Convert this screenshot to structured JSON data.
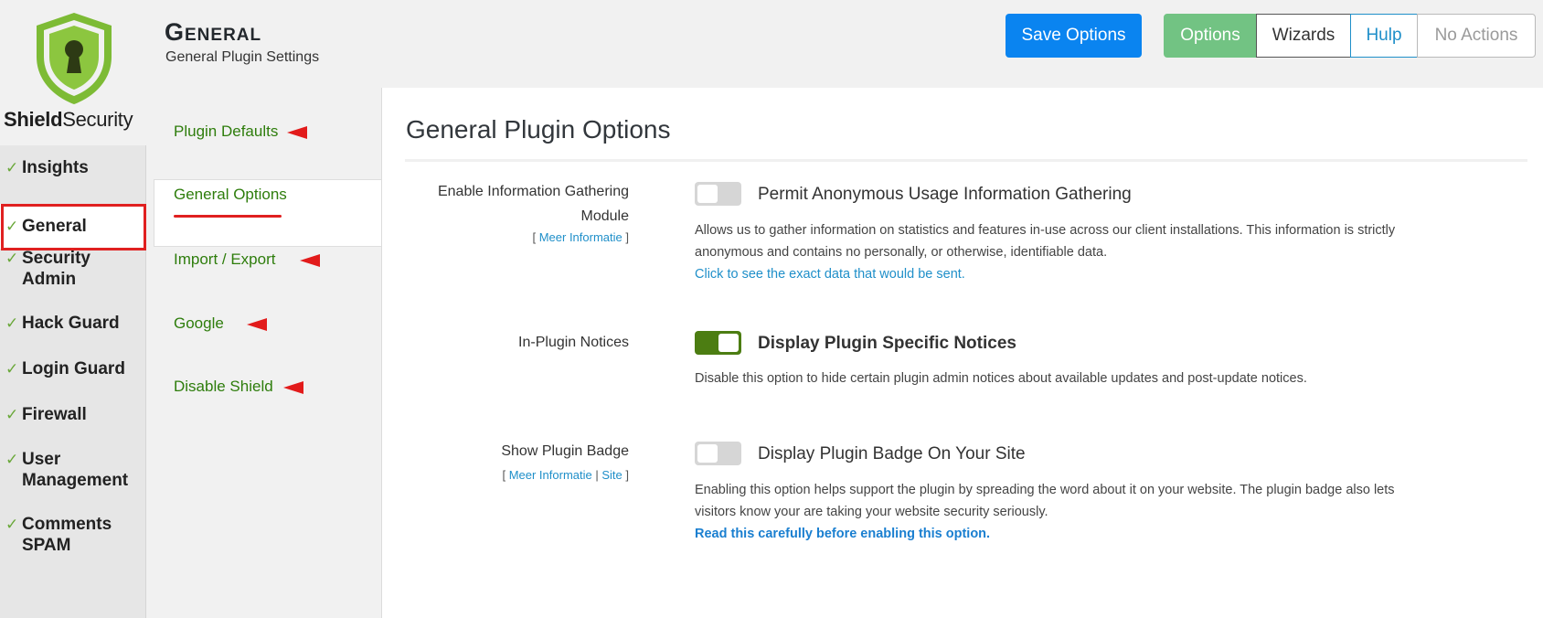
{
  "brand": {
    "name_bold": "Shield",
    "name_rest": "Security"
  },
  "nav": {
    "items": [
      {
        "label": "Insights",
        "check": "✓"
      },
      {
        "label": "General",
        "check": "✓"
      },
      {
        "label": "Security Admin",
        "check": "✓"
      },
      {
        "label": "Hack Guard",
        "check": "✓"
      },
      {
        "label": "Login Guard",
        "check": "✓"
      },
      {
        "label": "Firewall",
        "check": "✓"
      },
      {
        "label": "User Management",
        "check": "✓"
      },
      {
        "label": "Comments SPAM",
        "check": "✓"
      }
    ],
    "active": "General"
  },
  "header": {
    "title": "General",
    "subtitle": "General Plugin Settings",
    "save_label": "Save Options",
    "tabs": [
      "Options",
      "Wizards",
      "Hulp",
      "No Actions"
    ]
  },
  "subnav": {
    "items": [
      "Plugin Defaults",
      "General Options",
      "Import / Export",
      "Google",
      "Disable Shield"
    ],
    "active": "General Options"
  },
  "panel": {
    "title": "General Plugin Options",
    "options": [
      {
        "label_line1": "Enable Information Gathering",
        "label_line2": "Module",
        "link_open": "[ ",
        "link1": "Meer Informatie",
        "link_close": " ]",
        "enabled": false,
        "title": "Permit Anonymous Usage Information Gathering",
        "desc": "Allows us to gather information on statistics and features in-use across our client installations. This information is strictly anonymous and contains no personally, or otherwise, identifiable data.",
        "desc_link": "Click to see the exact data that would be sent."
      },
      {
        "label_line1": "In-Plugin Notices",
        "enabled": true,
        "title": "Display Plugin Specific Notices",
        "desc": "Disable this option to hide certain plugin admin notices about available updates and post-update notices."
      },
      {
        "label_line1": "Show Plugin Badge",
        "link_open": "[ ",
        "link1": "Meer Informatie",
        "link_sep": " | ",
        "link2": "Site",
        "link_close": " ]",
        "enabled": false,
        "title": "Display Plugin Badge On Your Site",
        "desc": "Enabling this option helps support the plugin by spreading the word about it on your website. The plugin badge also lets visitors know your are taking your website security seriously.",
        "desc_link": "Read this carefully before enabling this option."
      }
    ]
  },
  "colors": {
    "save_button": "#0a84f0",
    "options_tab": "#72c383",
    "toggle_on": "#4c7d12",
    "link": "#1f8fc9",
    "subnav_text": "#2e7d0c",
    "annotation_red": "#e02020",
    "check_green": "#6aa83a"
  },
  "icons": {
    "logo": "shield-keyhole-icon",
    "check": "checkmark-icon",
    "annotation": "red-arrow-icon"
  }
}
